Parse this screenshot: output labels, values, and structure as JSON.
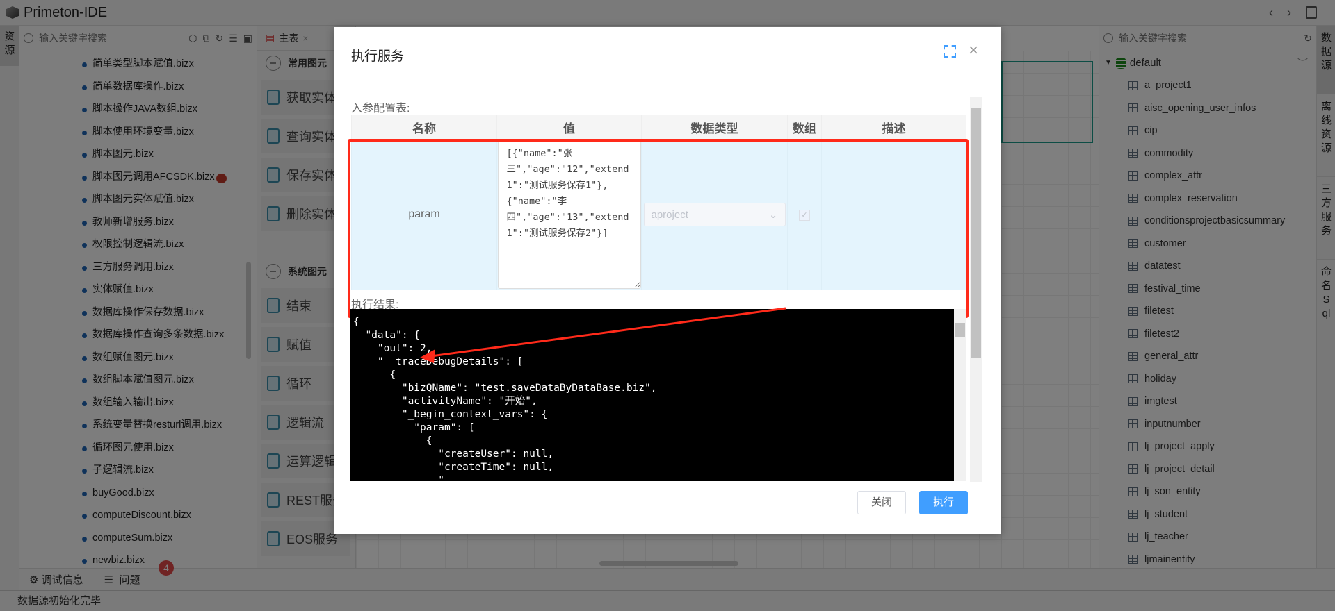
{
  "app": {
    "title": "Primeton-IDE"
  },
  "left_tabs": [
    "资源"
  ],
  "left_panel": {
    "search_placeholder": "输入关键字搜索",
    "files": [
      {
        "name": "简单类型脚本赋值.bizx"
      },
      {
        "name": "简单数据库操作.bizx"
      },
      {
        "name": "脚本操作JAVA数组.bizx"
      },
      {
        "name": "脚本使用环境变量.bizx"
      },
      {
        "name": "脚本图元.bizx"
      },
      {
        "name": "脚本图元调用AFCSDK.bizx",
        "error": "!"
      },
      {
        "name": "脚本图元实体赋值.bizx"
      },
      {
        "name": "教师新增服务.bizx"
      },
      {
        "name": "权限控制逻辑流.bizx"
      },
      {
        "name": "三方服务调用.bizx"
      },
      {
        "name": "实体赋值.bizx"
      },
      {
        "name": "数据库操作保存数据.bizx"
      },
      {
        "name": "数据库操作查询多条数据.bizx"
      },
      {
        "name": "数组赋值图元.bizx"
      },
      {
        "name": "数组脚本赋值图元.bizx"
      },
      {
        "name": "数组输入输出.bizx"
      },
      {
        "name": "系统变量替换resturl调用.bizx"
      },
      {
        "name": "循环图元使用.bizx"
      },
      {
        "name": "子逻辑流.bizx"
      },
      {
        "name": "buyGood.bizx"
      },
      {
        "name": "computeDiscount.bizx"
      },
      {
        "name": "computeSum.bizx"
      },
      {
        "name": "newbiz.bizx"
      }
    ]
  },
  "editor_tab": {
    "label": "主表"
  },
  "palette": {
    "sections": [
      {
        "title": "常用图元",
        "items": [
          "获取实体",
          "查询实体",
          "保存实体",
          "删除实体"
        ]
      },
      {
        "title": "系统图元",
        "items": [
          "结束",
          "赋值",
          "循环",
          "逻辑流",
          "运算逻辑",
          "REST服务",
          "EOS服务"
        ]
      }
    ]
  },
  "right_panel": {
    "search_placeholder": "输入关键字搜索",
    "root": "default",
    "tables": [
      "a_project1",
      "aisc_opening_user_infos",
      "cip",
      "commodity",
      "complex_attr",
      "complex_reservation",
      "conditionsprojectbasicsummary",
      "customer",
      "datatest",
      "festival_time",
      "filetest",
      "filetest2",
      "general_attr",
      "holiday",
      "imgtest",
      "inputnumber",
      "lj_project_apply",
      "lj_project_detail",
      "lj_son_entity",
      "lj_student",
      "lj_teacher",
      "ljmainentity"
    ]
  },
  "right_tabs": [
    "数据源",
    "离线资源",
    "三方服务",
    "命名Sql"
  ],
  "bottom": {
    "debug_label": "调试信息",
    "problems_label": "问题",
    "problems_count": "4"
  },
  "status": {
    "text": "数据源初始化完毕"
  },
  "dialog": {
    "title": "执行服务",
    "params_label": "入参配置表:",
    "columns": [
      "名称",
      "值",
      "数据类型",
      "数组",
      "描述"
    ],
    "row": {
      "name": "param",
      "value": "[{\"name\":\"张三\",\"age\":\"12\",\"extend1\":\"测试服务保存1\"},{\"name\":\"李四\",\"age\":\"13\",\"extend1\":\"测试服务保存2\"}]",
      "type": "aproject",
      "is_array": true,
      "desc": ""
    },
    "result_label": "执行结果:",
    "result_lines": [
      "{",
      "  \"data\": {",
      "    \"out\": 2,",
      "    \"__traceDebugDetails\": [",
      "      {",
      "        \"bizQName\": \"test.saveDataByDataBase.biz\",",
      "        \"activityName\": \"开始\",",
      "        \"_begin_context_vars\": {",
      "          \"param\": [",
      "            {",
      "              \"createUser\": null,",
      "              \"createTime\": null,",
      "              \"..."
    ],
    "close_label": "关闭",
    "run_label": "执行"
  },
  "colors": {
    "accent": "#409eff",
    "highlight": "#ff2a1a",
    "row_bg": "#e4f4fd"
  }
}
